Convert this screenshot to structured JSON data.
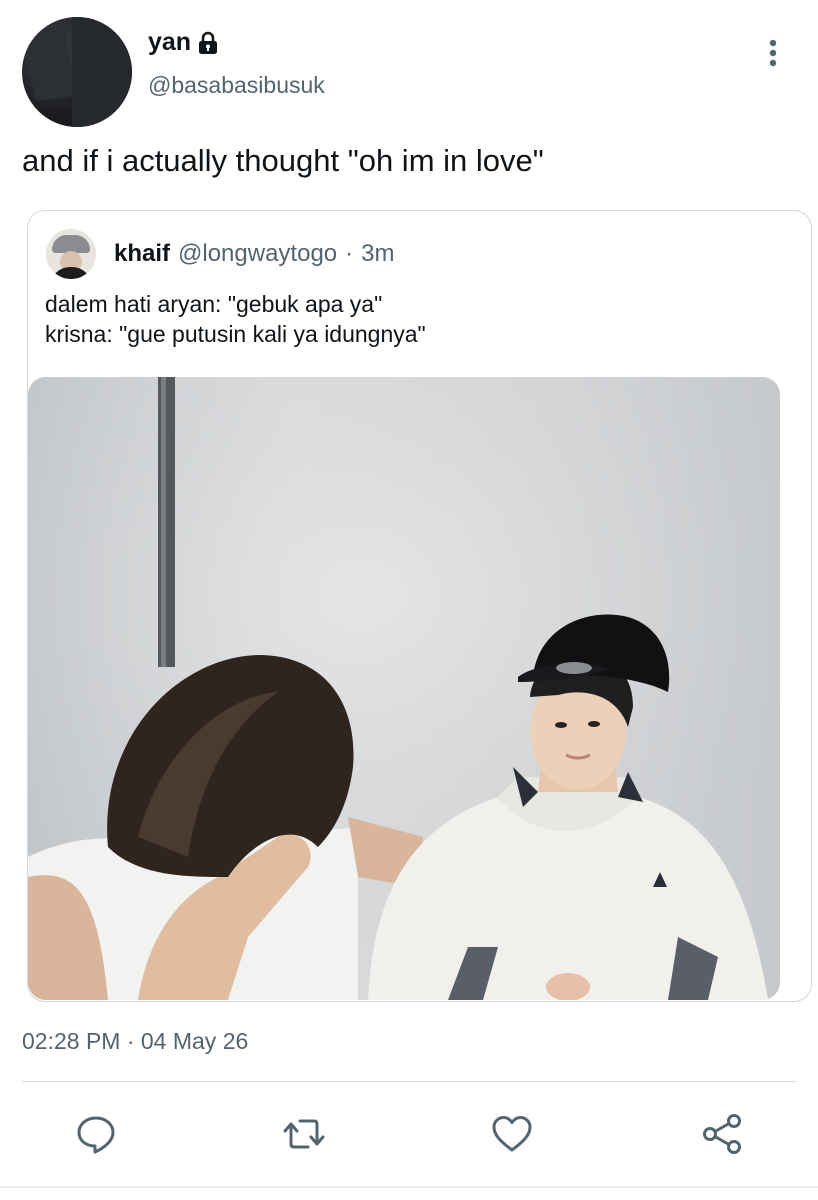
{
  "tweet": {
    "display_name": "yan",
    "handle": "@basabasibusuk",
    "text": "and if i actually thought \"oh im in love\"",
    "timestamp": "02:28 PM · 04 May 26"
  },
  "quoted": {
    "display_name": "khaif",
    "handle": "@longwaytogo",
    "separator": "·",
    "time": "3m",
    "lines": [
      "dalem hati aryan: \"gebuk apa ya\"",
      "krisna: \"gue putusin kali ya idungnya\""
    ]
  },
  "icons": {
    "lock": "lock-icon",
    "more": "more-vertical-icon",
    "reply": "reply-icon",
    "retweet": "retweet-icon",
    "like": "heart-icon",
    "share": "share-icon"
  },
  "colors": {
    "text": "#0f1419",
    "secondary": "#536471",
    "border": "#cfd9de",
    "icon": "#536471"
  }
}
